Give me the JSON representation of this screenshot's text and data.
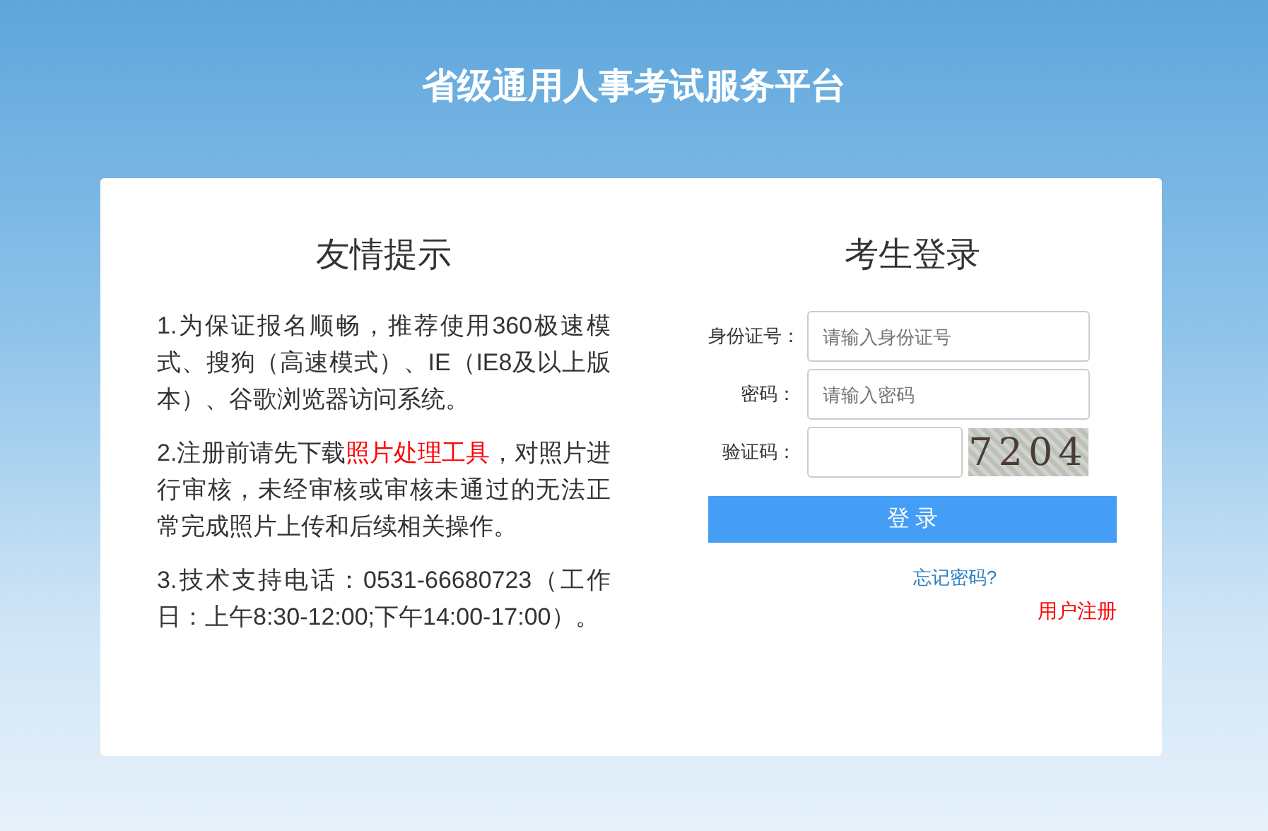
{
  "header": {
    "title": "省级通用人事考试服务平台"
  },
  "notice": {
    "title": "友情提示",
    "paragraphs": [
      {
        "text": "1.为保证报名顺畅，推荐使用360极速模式、搜狗（高速模式）、IE（IE8及以上版本）、谷歌浏览器访问系统。"
      },
      {
        "text": "2.注册前请先下载",
        "link": "照片处理工具",
        "after": "，对照片进行审核，未经审核或审核未通过的无法正常完成照片上传和后续相关操作。"
      },
      {
        "text": "3.技术支持电话：0531-66680723（工作日：上午8:30-12:00;下午14:00-17:00）。"
      }
    ]
  },
  "login": {
    "title": "考生登录",
    "fields": [
      {
        "label": "身份证号：",
        "placeholder": "请输入身份证号",
        "kind": "text"
      },
      {
        "label": "密码：",
        "placeholder": "请输入密码",
        "kind": "password"
      },
      {
        "label": "验证码：",
        "kind": "captcha",
        "captcha": "7204"
      }
    ],
    "submit": "登 录",
    "forgot": "忘记密码?",
    "register": "用户注册"
  }
}
